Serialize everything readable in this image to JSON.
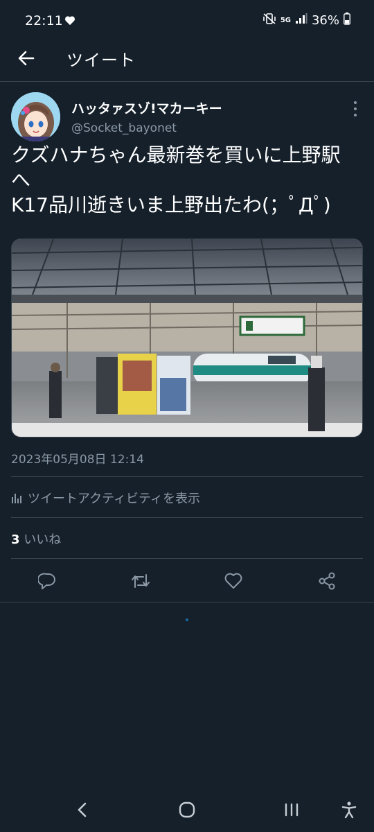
{
  "status_bar": {
    "time": "22:11",
    "battery": "36%",
    "network": "5G"
  },
  "header": {
    "title": "ツイート"
  },
  "tweet": {
    "display_name": "ハッタァスゾ!マカーキー",
    "handle": "@Socket_bayonet",
    "text_lines": [
      "クズハナちゃん最新巻を買いに上野駅",
      "へ",
      "K17品川逝きいま上野出たわ(；ﾟДﾟ)"
    ],
    "timestamp": "2023年05月08日 12:14",
    "activity_label": "ツイートアクティビティを表示",
    "like_count": "3",
    "like_label": "いいね"
  },
  "icons": {
    "back": "arrow-left-icon",
    "more": "more-vertical-icon",
    "reply": "reply-icon",
    "retweet": "retweet-icon",
    "like": "heart-icon",
    "share": "share-icon"
  },
  "colors": {
    "background": "#15202b",
    "text": "#ffffff",
    "secondary": "#8b98a5",
    "divider": "#38444d"
  }
}
